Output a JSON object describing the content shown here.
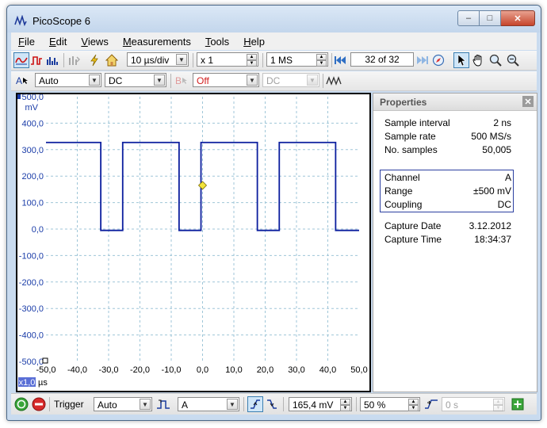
{
  "window": {
    "title": "PicoScope 6",
    "minimize": "–",
    "maximize": "□",
    "close": "✕"
  },
  "menu": [
    "File",
    "Edit",
    "Views",
    "Measurements",
    "Tools",
    "Help"
  ],
  "toolbar1": {
    "timebase": "10 µs/div",
    "zoom": "x 1",
    "samples": "1 MS",
    "buffer": "32 of 32"
  },
  "toolbar2": {
    "channel_letter": "A",
    "range": "Auto",
    "coupling": "DC",
    "channel_b_letter": "B",
    "channel_b_state": "Off",
    "channel_b_coupling": "DC"
  },
  "scope": {
    "y_unit": "mV",
    "x_unit": "µs",
    "zoom_badge": "x1,0",
    "y_ticks": [
      "500,0",
      "400,0",
      "300,0",
      "200,0",
      "100,0",
      "0,0",
      "-100,0",
      "-200,0",
      "-300,0",
      "-400,0",
      "-500,0"
    ],
    "x_ticks": [
      "-50,0",
      "-40,0",
      "-30,0",
      "-20,0",
      "-10,0",
      "0,0",
      "10,0",
      "20,0",
      "30,0",
      "40,0",
      "50,0"
    ],
    "trace_color": "#0b1e9e",
    "trigger_marker_color": "#f2e33a",
    "grid_color": "#9fc6d8"
  },
  "chart_data": {
    "type": "line",
    "title": "",
    "xlabel": "µs",
    "ylabel": "mV",
    "xlim": [
      -50,
      50
    ],
    "ylim": [
      -500,
      500
    ],
    "grid": true,
    "series": [
      {
        "x": [
          -50,
          -32.5,
          -32.5,
          -25.5,
          -25.5,
          -7.5,
          -7.5,
          -0.5,
          -0.5,
          17.5,
          17.5,
          24.5,
          24.5,
          42.5,
          42.5,
          50
        ],
        "values": [
          327,
          327,
          -5,
          -5,
          327,
          327,
          -5,
          -5,
          327,
          327,
          -5,
          -5,
          327,
          327,
          -5,
          -5
        ]
      }
    ],
    "trigger": {
      "x": 0,
      "y": 165
    }
  },
  "properties": {
    "title": "Properties",
    "rows": [
      {
        "k": "Sample interval",
        "v": "2 ns"
      },
      {
        "k": "Sample rate",
        "v": "500 MS/s"
      },
      {
        "k": "No. samples",
        "v": "50,005"
      }
    ],
    "channel": [
      {
        "k": "Channel",
        "v": "A"
      },
      {
        "k": "Range",
        "v": "±500 mV"
      },
      {
        "k": "Coupling",
        "v": "DC"
      }
    ],
    "capture": [
      {
        "k": "Capture Date",
        "v": "3.12.2012"
      },
      {
        "k": "Capture Time",
        "v": "18:34:37"
      }
    ]
  },
  "statusbar": {
    "trigger_label": "Trigger",
    "trigger_mode": "Auto",
    "trigger_source": "A",
    "threshold": "165,4 mV",
    "pre_trigger": "50 %",
    "delay": "0 s"
  }
}
